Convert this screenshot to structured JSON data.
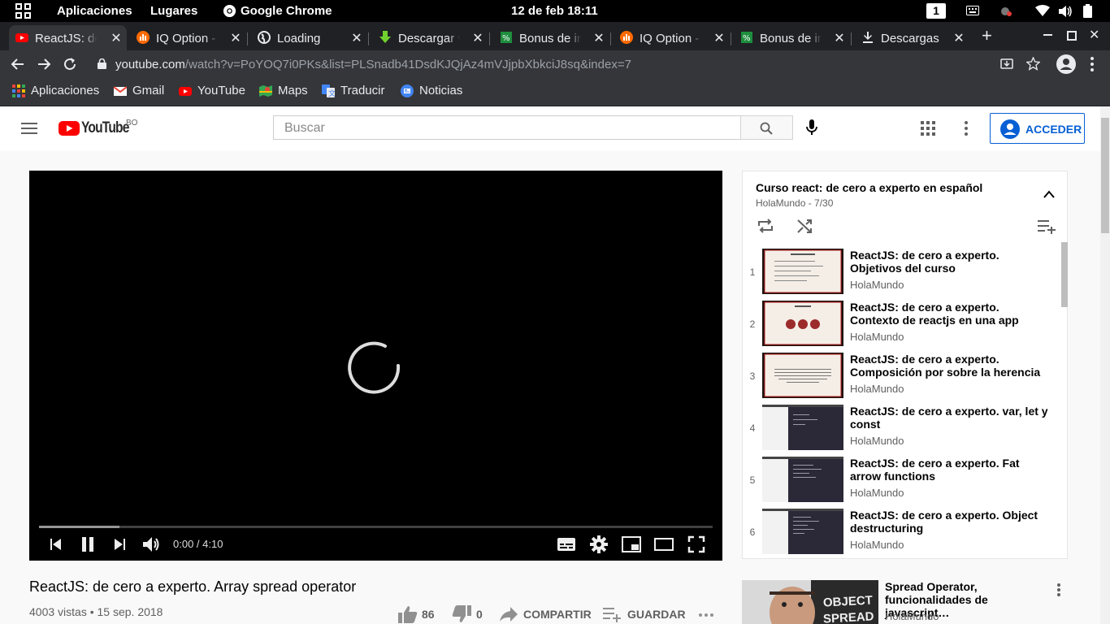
{
  "desktop": {
    "activities_icon": "grid-icon",
    "menu_apps": "Aplicaciones",
    "menu_places": "Lugares",
    "menu_active_app": "Google Chrome",
    "clock": "12 de feb  18:11",
    "workspace_number": "1"
  },
  "browser": {
    "tabs": [
      {
        "label": "ReactJS: de cero a experto",
        "icon": "youtube-icon",
        "active": true
      },
      {
        "label": "IQ Option - Broker",
        "icon": "iq-option-icon"
      },
      {
        "label": "Loading",
        "icon": "globe-icon"
      },
      {
        "label": "Descargar video",
        "icon": "download-arrow-icon"
      },
      {
        "label": "Bonus de ingreso",
        "icon": "bonus-icon"
      },
      {
        "label": "IQ Option - Broker",
        "icon": "iq-option-icon"
      },
      {
        "label": "Bonus de ingreso",
        "icon": "bonus-icon"
      },
      {
        "label": "Descargas",
        "icon": "downloads-icon"
      }
    ],
    "url_host": "youtube.com",
    "url_path": "/watch?v=PoYOQ7i0PKs&list=PLSnadb41DsdKJQjAz4mVJjpbXbkciJ8sq&index=7",
    "bookmarks": [
      {
        "label": "Aplicaciones",
        "icon": "apps-grid-icon"
      },
      {
        "label": "Gmail",
        "icon": "gmail-icon"
      },
      {
        "label": "YouTube",
        "icon": "youtube-icon"
      },
      {
        "label": "Maps",
        "icon": "maps-icon"
      },
      {
        "label": "Traducir",
        "icon": "translate-icon"
      },
      {
        "label": "Noticias",
        "icon": "news-icon"
      }
    ]
  },
  "youtube": {
    "logo_text": "YouTube",
    "country_code": "BO",
    "search_placeholder": "Buscar",
    "signin_label": "ACCEDER",
    "player": {
      "time_display": "0:00 / 4:10",
      "buffered_fraction": 0.12
    },
    "video": {
      "title": "ReactJS: de cero a experto. Array spread operator",
      "meta": "4003 vistas • 15 sep. 2018",
      "likes": "86",
      "dislikes": "0",
      "share_label": "COMPARTIR",
      "save_label": "GUARDAR"
    },
    "playlist": {
      "title": "Curso react: de cero a experto en español",
      "subtitle": "HolaMundo - 7/30",
      "items": [
        {
          "index": "1",
          "title": "ReactJS: de cero a experto. Objetivos del curso",
          "channel": "HolaMundo",
          "thumb": "slide"
        },
        {
          "index": "2",
          "title": "ReactJS: de cero a experto. Contexto de reactjs en una app",
          "channel": "HolaMundo",
          "thumb": "slide-circles"
        },
        {
          "index": "3",
          "title": "ReactJS: de cero a experto. Composición por sobre la herencia y…",
          "channel": "HolaMundo",
          "thumb": "slide-text"
        },
        {
          "index": "4",
          "title": "ReactJS: de cero a experto. var, let y const",
          "channel": "HolaMundo",
          "thumb": "editor"
        },
        {
          "index": "5",
          "title": "ReactJS: de cero a experto. Fat arrow functions",
          "channel": "HolaMundo",
          "thumb": "editor"
        },
        {
          "index": "6",
          "title": "ReactJS: de cero a experto. Object destructuring",
          "channel": "HolaMundo",
          "thumb": "editor"
        }
      ]
    },
    "recommended": {
      "thumb_text_line1": "OBJECT",
      "thumb_text_line2": "SPREAD",
      "title": "Spread Operator, funcionalidades de javascript…",
      "channel": "HolaMundo"
    }
  }
}
